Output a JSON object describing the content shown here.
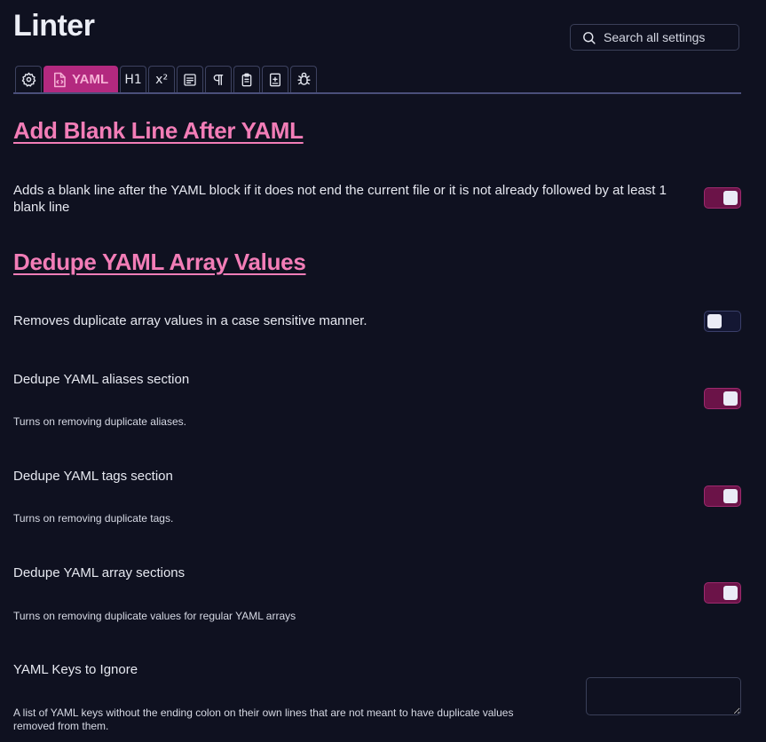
{
  "page": {
    "title": "Linter"
  },
  "search": {
    "placeholder": "Search all settings",
    "icon": "search-icon"
  },
  "tabs": [
    {
      "name": "general",
      "icon": "gear-icon"
    },
    {
      "name": "yaml",
      "icon": "file-code-icon",
      "label": "YAML",
      "active": true
    },
    {
      "name": "heading",
      "label": "H1"
    },
    {
      "name": "footnote",
      "label": "x²"
    },
    {
      "name": "content",
      "icon": "text-lines-icon"
    },
    {
      "name": "spacing",
      "icon": "pilcrow-icon"
    },
    {
      "name": "paste",
      "icon": "clipboard-icon"
    },
    {
      "name": "custom",
      "icon": "add-file-icon"
    },
    {
      "name": "debug",
      "icon": "bug-icon"
    }
  ],
  "sections": {
    "blank_line": {
      "heading": "Add Blank Line After YAML",
      "desc": "Adds a blank line after the YAML block if it does not end the current file or it is not already followed by at least 1 blank line",
      "enabled": true
    },
    "dedupe": {
      "heading": "Dedupe YAML Array Values",
      "desc": "Removes duplicate array values in a case sensitive manner.",
      "enabled": false,
      "aliases": {
        "name": "Dedupe YAML aliases section",
        "desc": "Turns on removing duplicate aliases.",
        "enabled": true
      },
      "tags": {
        "name": "Dedupe YAML tags section",
        "desc": "Turns on removing duplicate tags.",
        "enabled": true
      },
      "arrays": {
        "name": "Dedupe YAML array sections",
        "desc": "Turns on removing duplicate values for regular YAML arrays",
        "enabled": true
      },
      "ignore": {
        "name": "YAML Keys to Ignore",
        "desc_line1": "A list of YAML keys without the ending colon on their own lines that are not meant to have duplicate values",
        "desc_line2": "removed from them.",
        "value": ""
      }
    }
  },
  "colors": {
    "accent": "#f27db7",
    "active_tab": "#b3297f",
    "toggle_on": "#6b1348",
    "background": "#0f1120"
  }
}
